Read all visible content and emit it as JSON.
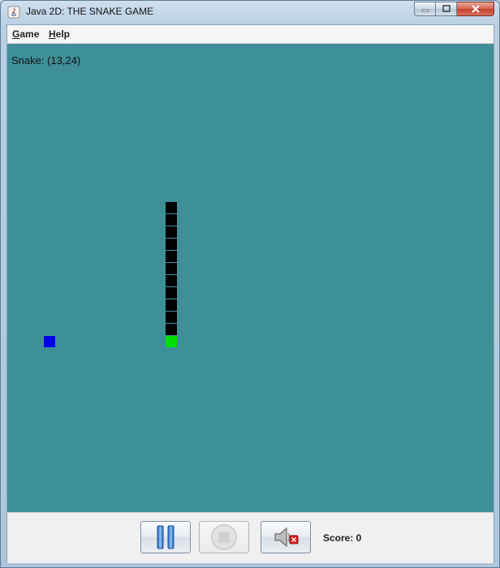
{
  "window": {
    "title": "Java 2D: THE SNAKE GAME"
  },
  "menu": [
    {
      "label": "Game",
      "mnemonic": "G",
      "rest": "ame"
    },
    {
      "label": "Help",
      "mnemonic": "H",
      "rest": "elp"
    }
  ],
  "game": {
    "status": "Snake: (13,24)",
    "background_color": "#3f8f99",
    "snake_color": "#000000",
    "head_color": "#00e000",
    "food_color": "#0000ee"
  },
  "controls": {
    "pause_icon": "pause-icon",
    "stop_icon": "stop-icon",
    "mute_icon": "speaker-muted-icon",
    "score_text": "Score: 0"
  }
}
